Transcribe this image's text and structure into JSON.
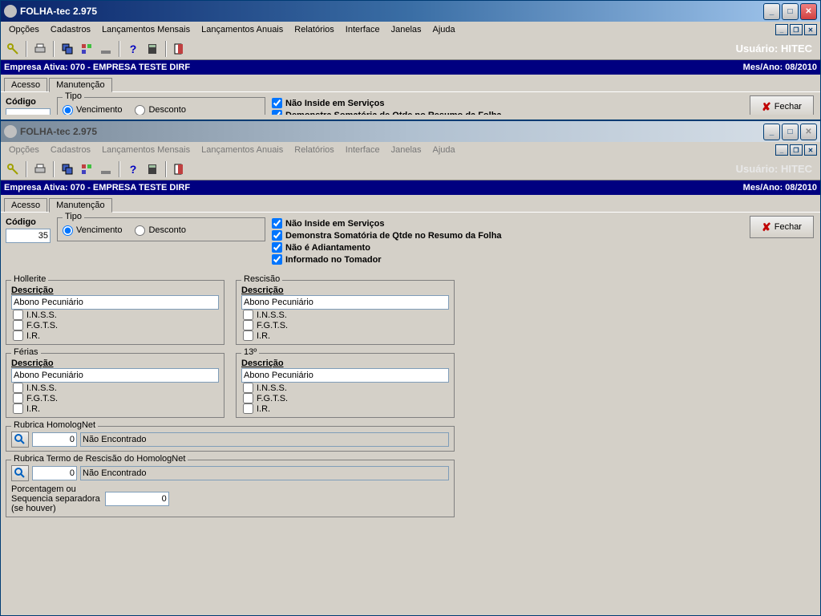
{
  "app_title": "FOLHA-tec 2.975",
  "menus": [
    "Opções",
    "Cadastros",
    "Lançamentos Mensais",
    "Lançamentos Anuais",
    "Relatórios",
    "Interface",
    "Janelas",
    "Ajuda"
  ],
  "user_label": "Usuário: HITEC",
  "bluebar": {
    "left": "Empresa Ativa: 070 - EMPRESA TESTE DIRF",
    "right": "Mes/Ano: 08/2010"
  },
  "tabs": {
    "acesso": "Acesso",
    "manutencao": "Manutenção"
  },
  "close_button": "Fechar",
  "codigo": {
    "label": "Código",
    "value": "35"
  },
  "tipo": {
    "legend": "Tipo",
    "vencimento": "Vencimento",
    "desconto": "Desconto"
  },
  "flags": {
    "nao_inside": "Não Inside em Serviços",
    "demonstra": "Demonstra Somatória de Qtde no Resumo da Folha",
    "nao_adiant": "Não é Adiantamento",
    "informado": "Informado no Tomador"
  },
  "groups": {
    "hollerite": "Hollerite",
    "rescisao": "Rescisão",
    "ferias": "Férias",
    "decimo": "13º",
    "descricao": "Descrição",
    "desc_value": "Abono Pecuniário",
    "inss": "I.N.S.S.",
    "fgts": "F.G.T.S.",
    "ir": "I.R."
  },
  "rubrica1": {
    "legend": "Rubrica HomologNet",
    "code": "0",
    "text": "Não Encontrado"
  },
  "rubrica2": {
    "legend": "Rubrica Termo de Rescisão do HomologNet",
    "code": "0",
    "text": "Não Encontrado"
  },
  "porcent": {
    "label1": "Porcentagem ou",
    "label2": "Sequencia separadora",
    "label3": "(se houver)",
    "value": "0"
  }
}
